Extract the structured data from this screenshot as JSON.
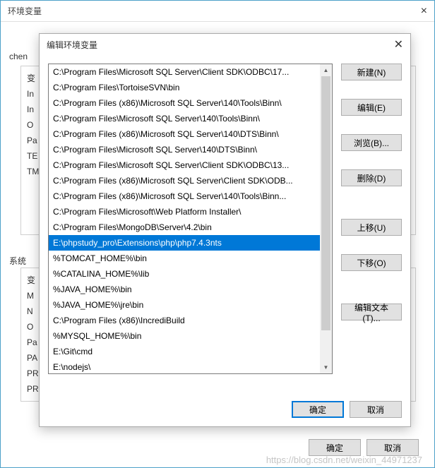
{
  "outer": {
    "title": "环境变量",
    "user_label": "chen",
    "sys_label": "系统",
    "bg_user_rows": [
      "变",
      "In",
      "In",
      "O",
      "Pa",
      "TE",
      "TM"
    ],
    "bg_sys_rows": [
      "变",
      "M",
      "N",
      "O",
      "Pa",
      "PA",
      "PR",
      "PR"
    ],
    "ok": "确定",
    "cancel": "取消"
  },
  "inner": {
    "title": "编辑环境变量",
    "buttons": {
      "new": "新建(N)",
      "edit": "编辑(E)",
      "browse": "浏览(B)...",
      "delete": "删除(D)",
      "moveup": "上移(U)",
      "movedown": "下移(O)",
      "edittext": "编辑文本(T)..."
    },
    "ok": "确定",
    "cancel": "取消",
    "selected_index": 11,
    "items": [
      "C:\\Program Files\\Microsoft SQL Server\\Client SDK\\ODBC\\17...",
      "C:\\Program Files\\TortoiseSVN\\bin",
      "C:\\Program Files (x86)\\Microsoft SQL Server\\140\\Tools\\Binn\\",
      "C:\\Program Files\\Microsoft SQL Server\\140\\Tools\\Binn\\",
      "C:\\Program Files (x86)\\Microsoft SQL Server\\140\\DTS\\Binn\\",
      "C:\\Program Files\\Microsoft SQL Server\\140\\DTS\\Binn\\",
      "C:\\Program Files\\Microsoft SQL Server\\Client SDK\\ODBC\\13...",
      "C:\\Program Files (x86)\\Microsoft SQL Server\\Client SDK\\ODB...",
      "C:\\Program Files (x86)\\Microsoft SQL Server\\140\\Tools\\Binn...",
      "C:\\Program Files\\Microsoft\\Web Platform Installer\\",
      "C:\\Program Files\\MongoDB\\Server\\4.2\\bin",
      "E:\\phpstudy_pro\\Extensions\\php\\php7.4.3nts",
      "%TOMCAT_HOME%\\bin",
      "%CATALINA_HOME%\\lib",
      "%JAVA_HOME%\\bin",
      "%JAVA_HOME%\\jre\\bin",
      "C:\\Program Files (x86)\\IncrediBuild",
      "%MYSQL_HOME%\\bin",
      "E:\\Git\\cmd",
      "E:\\nodejs\\"
    ]
  },
  "watermark": "https://blog.csdn.net/weixin_44971237"
}
